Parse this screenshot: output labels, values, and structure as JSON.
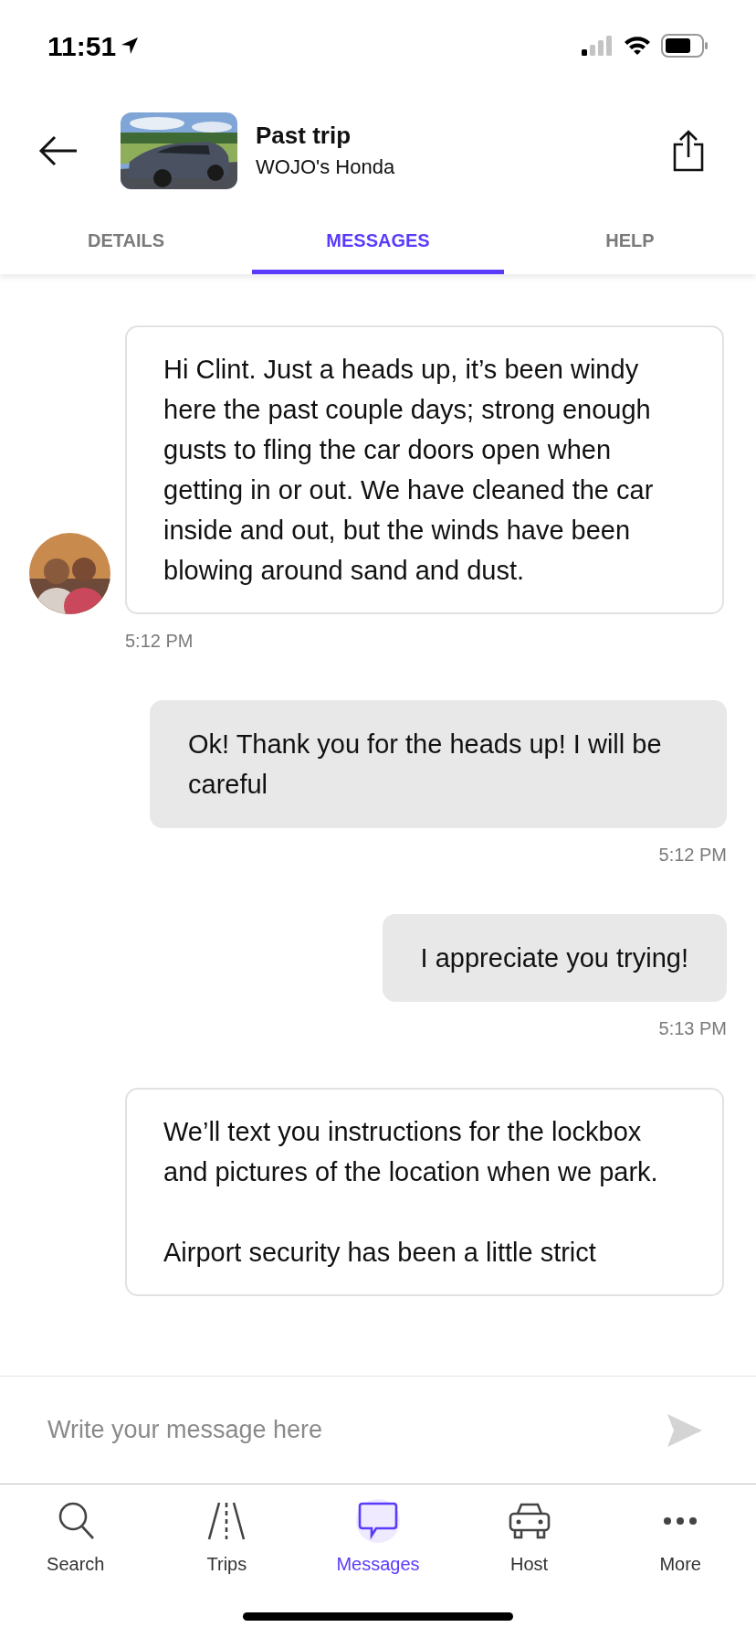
{
  "status_bar": {
    "time": "11:51"
  },
  "header": {
    "title": "Past trip",
    "subtitle": "WOJO's Honda"
  },
  "tabs": [
    {
      "label": "DETAILS",
      "selected": false
    },
    {
      "label": "MESSAGES",
      "selected": true
    },
    {
      "label": "HELP",
      "selected": false
    }
  ],
  "messages": [
    {
      "kind": "received",
      "show_avatar": true,
      "text": "Hi Clint. Just a heads up, it’s been windy here the past couple days; strong enough gusts to fling the car doors open when getting in or out. We have cleaned the car inside and out, but the winds have been blowing around sand and dust.",
      "time": "5:12 PM"
    },
    {
      "kind": "sent",
      "text": "Ok! Thank you for the heads up! I will be careful",
      "time": "5:12 PM"
    },
    {
      "kind": "sent",
      "text": "I appreciate you trying!",
      "time": "5:13 PM"
    },
    {
      "kind": "received",
      "show_avatar": false,
      "text": "We’ll text you instructions for the lockbox and pictures of the location when we park.\n\nAirport security has been a little strict"
    }
  ],
  "composer": {
    "placeholder": "Write your message here"
  },
  "nav": [
    {
      "label": "Search",
      "selected": false
    },
    {
      "label": "Trips",
      "selected": false
    },
    {
      "label": "Messages",
      "selected": true
    },
    {
      "label": "Host",
      "selected": false
    },
    {
      "label": "More",
      "selected": false
    }
  ]
}
